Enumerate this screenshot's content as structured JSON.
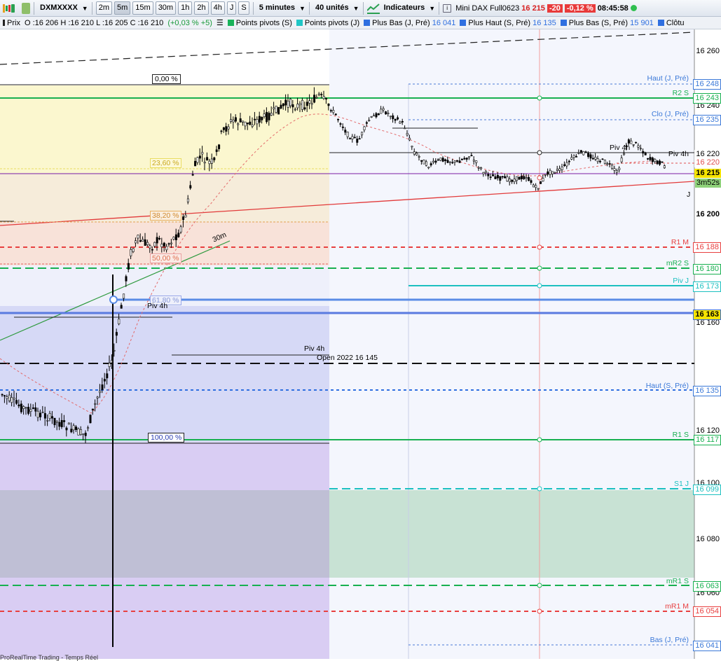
{
  "toolbar": {
    "symbol": "DXMXXXX",
    "timeframes": [
      "2m",
      "5m",
      "15m",
      "30m",
      "1h",
      "2h",
      "4h",
      "J",
      "S"
    ],
    "active_timeframe": "5m",
    "period": "5 minutes",
    "units": "40 unités",
    "indicators": "Indicateurs",
    "instrument": "Mini DAX Full0623",
    "last_price": "16 215",
    "change_abs": "-20",
    "change_pct": "-0,12 %",
    "clock": "08:45:58"
  },
  "infobar": {
    "price_label": "Prix",
    "ohlc": "O :16 206 H :16 210 L :16 205 C :16 210",
    "change": "(+0,03 % +5)",
    "legend": [
      {
        "label": "Points pivots (S)",
        "value": "",
        "color": "#19b35a"
      },
      {
        "label": "Points pivots (J)",
        "value": "",
        "color": "#1fc6c6"
      },
      {
        "label": "Plus Bas (J, Pré)",
        "value": "16 041",
        "color": "#2f6fe0"
      },
      {
        "label": "Plus Haut (S, Pré)",
        "value": "16 135",
        "color": "#2f6fe0"
      },
      {
        "label": "Plus Bas (S, Pré)",
        "value": "15 901",
        "color": "#2f6fe0"
      },
      {
        "label": "Clôtu",
        "value": "",
        "color": "#2f6fe0"
      }
    ]
  },
  "price_axis": {
    "ticks": [
      "16 260",
      "16 240",
      "16 200",
      "16 160",
      "16 120",
      "16 100",
      "16 080",
      "16 060"
    ],
    "current_price": "16 215",
    "countdown": "3m52s"
  },
  "levels": [
    {
      "name": "Haut (J, Pré)",
      "price": "16 248",
      "color": "#3a78d8"
    },
    {
      "name": "R2 S",
      "price": "16 243",
      "color": "#18b050"
    },
    {
      "name": "Clo (J, Pré)",
      "price": "16 235",
      "color": "#3a78d8"
    },
    {
      "name": "Piv 4h",
      "price": "16 220",
      "color": "#000000"
    },
    {
      "name": "",
      "price": "16 220",
      "color": "#e05050"
    },
    {
      "name": "R1 M",
      "price": "16 188",
      "color": "#e84040"
    },
    {
      "name": "mR2 S",
      "price": "16 180",
      "color": "#18b050"
    },
    {
      "name": "Piv J",
      "price": "16 173",
      "color": "#1cc0c0"
    },
    {
      "name": "",
      "price": "16 163",
      "color": "#3a6fe0"
    },
    {
      "name": "Haut (S, Pré)",
      "price": "16 135",
      "color": "#3a78d8"
    },
    {
      "name": "R1 S",
      "price": "16 117",
      "color": "#18b050"
    },
    {
      "name": "S1 J",
      "price": "16 099",
      "color": "#1cc0c0"
    },
    {
      "name": "mR1 S",
      "price": "16 063",
      "color": "#18b050"
    },
    {
      "name": "mR1 M",
      "price": "16 054",
      "color": "#e84040"
    },
    {
      "name": "Bas (J, Pré)",
      "price": "16 041",
      "color": "#3a78d8"
    }
  ],
  "fib": [
    "0,00 %",
    "23,60 %",
    "38,20 %",
    "50,00 %",
    "61,80 %",
    "100,00 %"
  ],
  "annotations": {
    "trend_label": "30m",
    "piv4h_a": "Piv 4h",
    "piv4h_b": "Piv 4h",
    "piv4h_c": "Piv 4h",
    "open_2022": "Open 2022 16 145",
    "marker_j": "J",
    "footer": "ProRealTime Trading - Temps Réel"
  }
}
